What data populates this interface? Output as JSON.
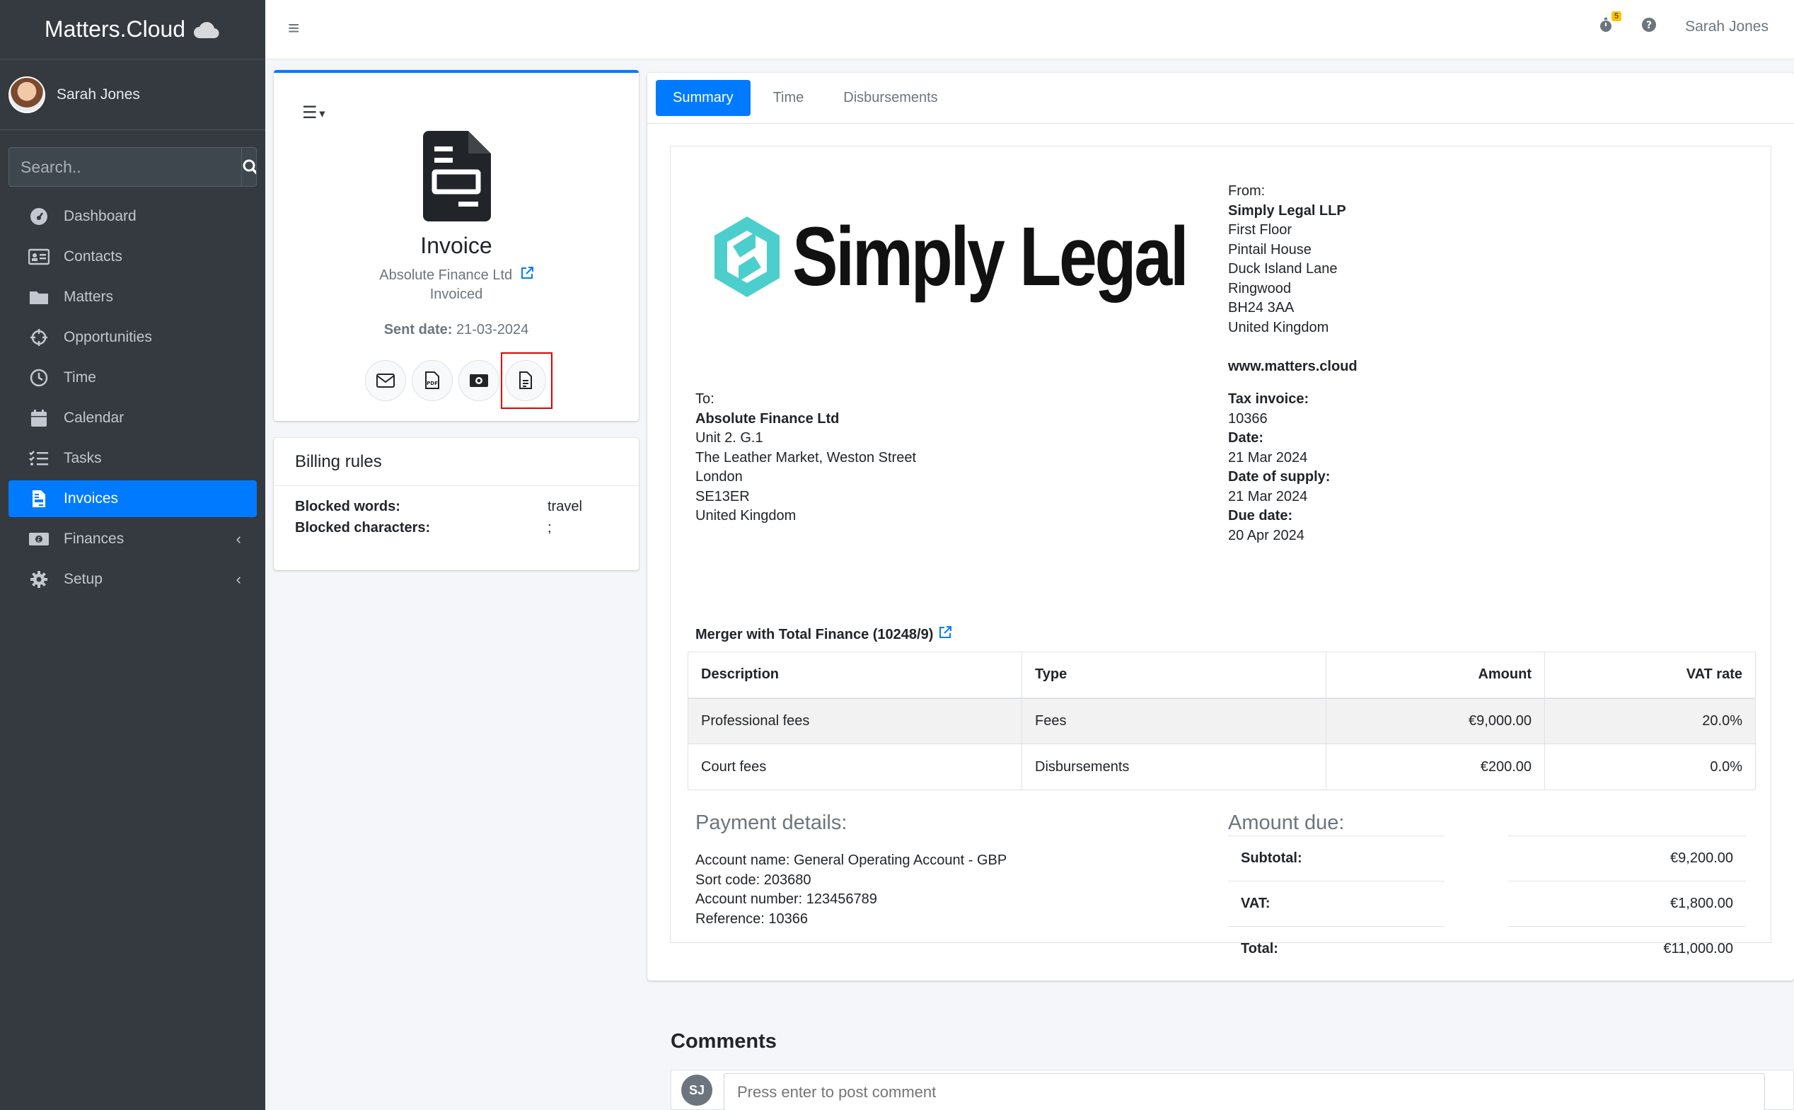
{
  "brand": {
    "name": "Matters.Cloud"
  },
  "user": {
    "name": "Sarah Jones",
    "initials": "SJ"
  },
  "search": {
    "placeholder": "Search.."
  },
  "sidebar": {
    "items": [
      {
        "label": "Dashboard"
      },
      {
        "label": "Contacts"
      },
      {
        "label": "Matters"
      },
      {
        "label": "Opportunities"
      },
      {
        "label": "Time"
      },
      {
        "label": "Calendar"
      },
      {
        "label": "Tasks"
      },
      {
        "label": "Invoices"
      },
      {
        "label": "Finances"
      },
      {
        "label": "Setup"
      }
    ]
  },
  "topbar": {
    "user_name": "Sarah Jones",
    "notif_count": "5"
  },
  "invoice_card": {
    "title": "Invoice",
    "client": "Absolute Finance Ltd",
    "status": "Invoiced",
    "sent_label": "Sent date:",
    "sent_value": "21-03-2024"
  },
  "billing": {
    "title": "Billing rules",
    "rows": [
      {
        "key": "Blocked words:",
        "value": "travel"
      },
      {
        "key": "Blocked characters:",
        "value": ";"
      }
    ]
  },
  "tabs": [
    {
      "label": "Summary"
    },
    {
      "label": "Time"
    },
    {
      "label": "Disbursements"
    }
  ],
  "invoice": {
    "logo_text": "Simply Legal",
    "from_label": "From:",
    "from_name": "Simply Legal LLP",
    "from_address": [
      "First Floor",
      "Pintail House",
      "Duck Island Lane",
      "Ringwood",
      "BH24 3AA",
      "United Kingdom"
    ],
    "website": "www.matters.cloud",
    "to_label": "To:",
    "to_name": "Absolute Finance Ltd",
    "to_address": [
      "Unit 2. G.1",
      "The Leather Market, Weston Street",
      "London",
      "SE13ER",
      "United Kingdom"
    ],
    "tax_invoice_label": "Tax invoice:",
    "tax_invoice_value": "10366",
    "date_label": "Date:",
    "date_value": "21 Mar 2024",
    "supply_label": "Date of supply:",
    "supply_value": "21 Mar 2024",
    "due_label": "Due date:",
    "due_value": "20 Apr 2024",
    "matter": "Merger with Total Finance (10248/9)",
    "columns": [
      "Description",
      "Type",
      "Amount",
      "VAT rate"
    ],
    "rows": [
      {
        "description": "Professional fees",
        "type": "Fees",
        "amount": "€9,000.00",
        "vat": "20.0%"
      },
      {
        "description": "Court fees",
        "type": "Disbursements",
        "amount": "€200.00",
        "vat": "0.0%"
      }
    ],
    "payment_title": "Payment details:",
    "payment_lines": [
      "Account name: General Operating Account - GBP",
      "Sort code: 203680",
      "Account number: 123456789",
      "Reference: 10366"
    ],
    "due_title": "Amount due:",
    "totals": [
      {
        "key": "Subtotal:",
        "value": "€9,200.00"
      },
      {
        "key": "VAT:",
        "value": "€1,800.00"
      },
      {
        "key": "Total:",
        "value": "€11,000.00"
      }
    ]
  },
  "comments": {
    "title": "Comments",
    "placeholder": "Press enter to post comment"
  },
  "colors": {
    "primary": "#007bff",
    "sidebar": "#343a40",
    "logo_teal": "#4ccfcc",
    "highlight": "#e00000"
  }
}
